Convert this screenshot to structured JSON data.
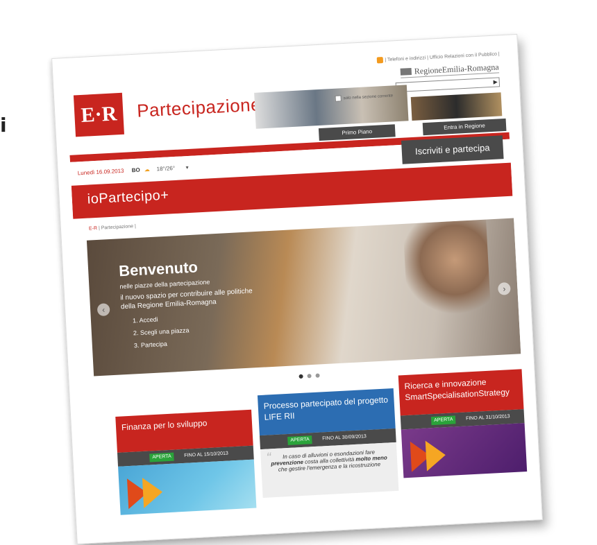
{
  "edge_glyph": "i",
  "header": {
    "top_links": "| Telefoni e indirizzi | Ufficio Relazioni con il Pubblico |",
    "region_logo": "RegioneEmilia-Romagna",
    "search_placeholder": "",
    "search_scope_label": "solo nella sezione corrente",
    "logo_text": "E·R",
    "site_name": "Partecipazione",
    "tabs": [
      "Primo Piano",
      "Entra in Regione"
    ]
  },
  "datebar": {
    "date": "Lunedì 16.09.2013",
    "city": "BO",
    "temperature": "18°/26°",
    "cta": "Iscriviti e partecipa"
  },
  "section_title": "ioPartecipo+",
  "breadcrumb": {
    "root": "E-R",
    "current": "Partecipazione"
  },
  "slider": {
    "title": "Benvenuto",
    "subtitle": "nelle piazze della partecipazione",
    "body_line1": "il nuovo spazio per contribuire alle politiche",
    "body_line2": "della Regione Emilia-Romagna",
    "steps": [
      "1. Accedi",
      "2. Scegli una piazza",
      "3. Partecipa"
    ]
  },
  "cards": [
    {
      "title": "Finanza per lo sviluppo",
      "status": "APERTA",
      "deadline": "FINO AL 15/10/2013",
      "color": "#c8251f"
    },
    {
      "title": "Processo partecipato del progetto LIFE RII",
      "status": "APERTA",
      "deadline": "FINO AL 30/09/2013",
      "color": "#2c6db2",
      "quote_pre": "In caso di alluvioni o esondazioni fare ",
      "quote_em1": "prevenzione",
      "quote_mid": " costa alla collettività ",
      "quote_em2": "molto meno",
      "quote_post": " che gestire l'emergenza e la ricostruzione"
    },
    {
      "title": "Ricerca e innovazione SmartSpecialisationStrategy",
      "status": "APERTA",
      "deadline": "FINO AL 31/10/2013",
      "color": "#c8251f"
    }
  ],
  "colors": {
    "brand_red": "#c8251f",
    "dark_gray": "#4a4a4a",
    "status_green": "#2aa33a",
    "blue": "#2c6db2"
  }
}
